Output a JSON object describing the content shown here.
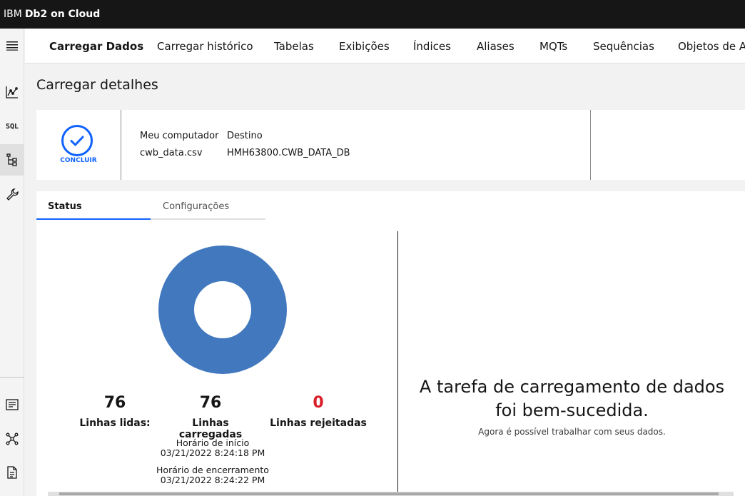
{
  "header": {
    "brand_prefix": "IBM",
    "brand_product": "Db2 on Cloud"
  },
  "nav_tabs": [
    {
      "label": "Carregar Dados",
      "active": true
    },
    {
      "label": "Carregar histórico",
      "active": false
    },
    {
      "label": "Tabelas",
      "active": false
    },
    {
      "label": "Exibições",
      "active": false
    },
    {
      "label": "Índices",
      "active": false
    },
    {
      "label": "Aliases",
      "active": false
    },
    {
      "label": "MQTs",
      "active": false
    },
    {
      "label": "Sequências",
      "active": false
    },
    {
      "label": "Objetos de Ap",
      "active": false
    }
  ],
  "rail": {
    "sql_label": "SQL"
  },
  "page": {
    "title": "Carregar detalhes"
  },
  "summary": {
    "status_label": "CONCLUIR",
    "source_header": "Meu computador",
    "source_value": "cwb_data.csv",
    "target_header": "Destino",
    "target_value": "HMH63800.CWB_DATA_DB"
  },
  "content_tabs": [
    {
      "label": "Status",
      "active": true
    },
    {
      "label": "Configurações",
      "active": false
    }
  ],
  "stats": {
    "read_value": "76",
    "read_label": "Linhas lidas:",
    "loaded_value": "76",
    "loaded_label": "Linhas carregadas",
    "rejected_value": "0",
    "rejected_label": "Linhas rejeitadas"
  },
  "times": {
    "start_label": "Horário de início",
    "start_value": "03/21/2022 8:24:18 PM",
    "end_label": "Horário de encerramento",
    "end_value": "03/21/2022 8:24:22 PM"
  },
  "result": {
    "title_line1": "A tarefa de carregamento de dados",
    "title_line2": "foi bem-sucedida.",
    "subtitle": "Agora é possível trabalhar com seus dados."
  },
  "colors": {
    "accent": "#0f62fe",
    "donut": "#4178be",
    "rejected": "#da1e28",
    "topbar": "#161616"
  }
}
